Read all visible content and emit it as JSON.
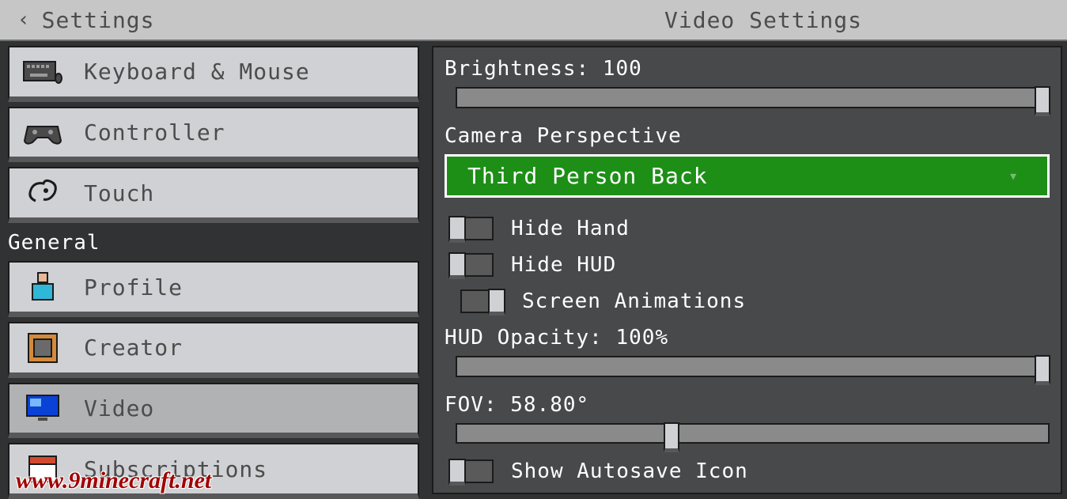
{
  "header": {
    "back_label": "Settings",
    "page_title": "Video Settings"
  },
  "sidebar": {
    "items_top": [
      {
        "label": "Keyboard & Mouse",
        "icon": "keyboard-icon"
      },
      {
        "label": "Controller",
        "icon": "controller-icon"
      },
      {
        "label": "Touch",
        "icon": "touch-icon"
      }
    ],
    "section_general": "General",
    "items_general": [
      {
        "label": "Profile",
        "icon": "profile-icon",
        "selected": false
      },
      {
        "label": "Creator",
        "icon": "creator-icon",
        "selected": false
      },
      {
        "label": "Video",
        "icon": "video-icon",
        "selected": true
      },
      {
        "label": "Subscriptions",
        "icon": "subscriptions-icon",
        "selected": false
      }
    ]
  },
  "video": {
    "brightness_label": "Brightness: 100",
    "brightness_percent": 100,
    "camera_label": "Camera Perspective",
    "camera_value": "Third Person Back",
    "hide_hand_label": "Hide Hand",
    "hide_hand_on": false,
    "hide_hud_label": "Hide HUD",
    "hide_hud_on": false,
    "screen_anim_label": "Screen Animations",
    "screen_anim_on": true,
    "hud_opacity_label": "HUD Opacity: 100%",
    "hud_opacity_percent": 100,
    "fov_label": "FOV: 58.80°",
    "fov_percent": 35,
    "autosave_label": "Show Autosave Icon",
    "autosave_on": false
  },
  "watermark": "www.9minecraft.net"
}
